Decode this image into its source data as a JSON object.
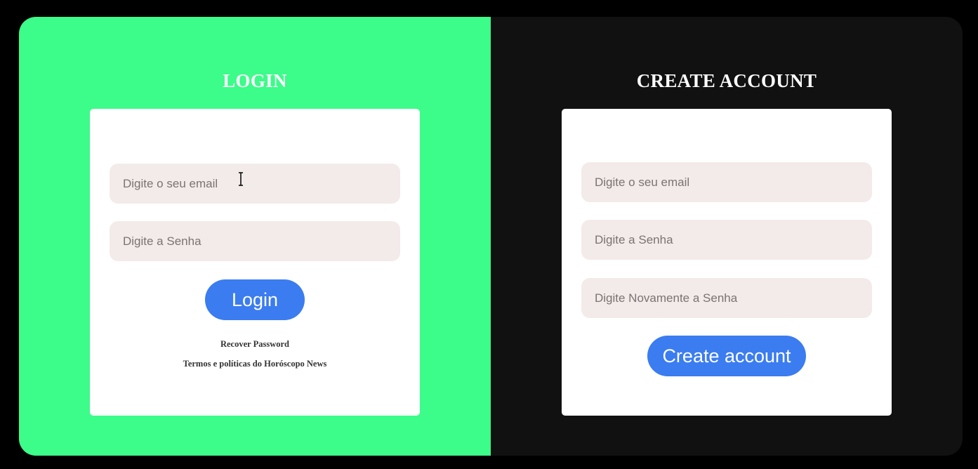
{
  "login": {
    "title": "LOGIN",
    "email_placeholder": "Digite o seu email",
    "password_placeholder": "Digite a Senha",
    "button_label": "Login",
    "recover_link": "Recover Password",
    "terms_link": "Termos e políticas do Horóscopo News"
  },
  "create_account": {
    "title": "CREATE ACCOUNT",
    "email_placeholder": "Digite o seu email",
    "password_placeholder": "Digite a Senha",
    "confirm_password_placeholder": "Digite Novamente a Senha",
    "button_label": "Create account"
  },
  "colors": {
    "left_panel": "#3cfc8a",
    "right_panel": "#111111",
    "button": "#3b7cf0",
    "field": "#f3ebe9"
  }
}
